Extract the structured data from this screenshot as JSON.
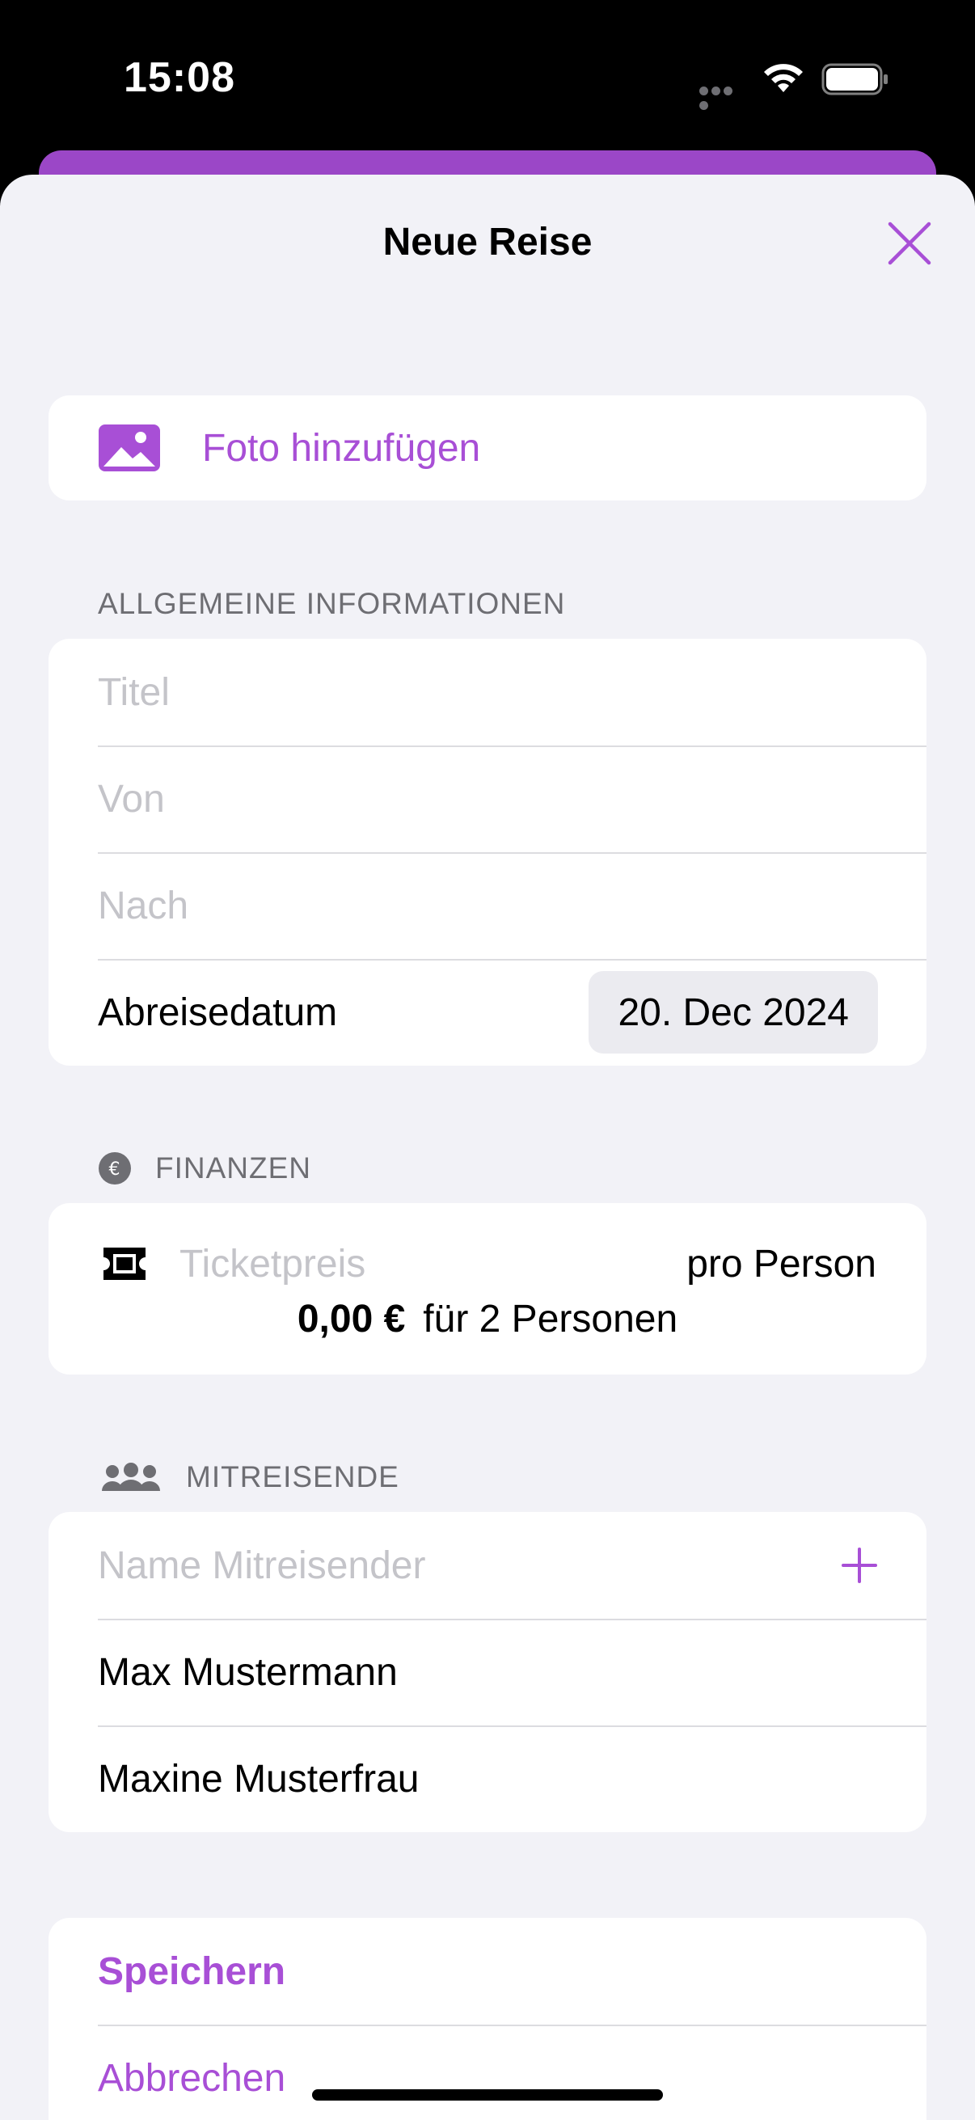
{
  "status_bar": {
    "time": "15:08"
  },
  "sheet": {
    "title": "Neue Reise"
  },
  "photo": {
    "label": "Foto hinzufügen"
  },
  "general": {
    "header": "ALLGEMEINE INFORMATIONEN",
    "title_placeholder": "Titel",
    "from_placeholder": "Von",
    "to_placeholder": "Nach",
    "departure_label": "Abreisedatum",
    "departure_value": "20. Dec 2024"
  },
  "finance": {
    "header": "FINANZEN",
    "ticket_placeholder": "Ticketpreis",
    "per_person": "pro Person",
    "total_amount": "0,00 €",
    "total_suffix": "für 2 Personen"
  },
  "companions": {
    "header": "MITREISENDE",
    "name_placeholder": "Name Mitreisender",
    "items": [
      "Max Mustermann",
      "Maxine Musterfrau"
    ]
  },
  "actions": {
    "save": "Speichern",
    "cancel": "Abbrechen"
  },
  "colors": {
    "accent": "#a84fd6",
    "background": "#f2f2f7",
    "header_bar": "#9b47c7"
  }
}
